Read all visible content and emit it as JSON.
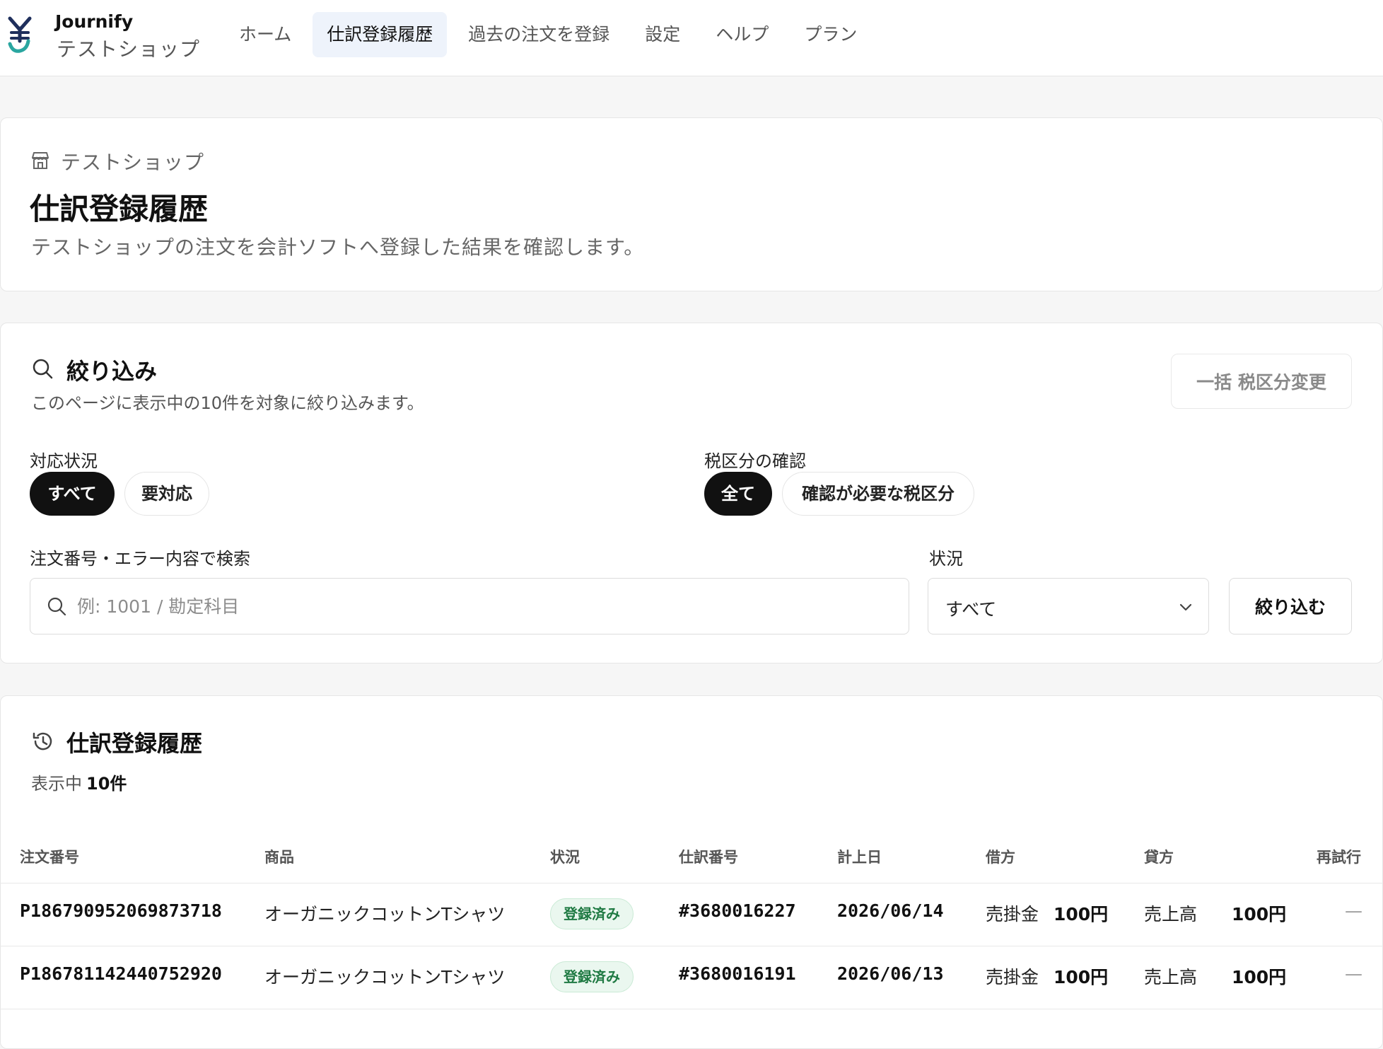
{
  "app": {
    "brand_name": "Journify",
    "shop_name": "テストショップ"
  },
  "nav": {
    "items": [
      {
        "label": "ホーム",
        "active": false
      },
      {
        "label": "仕訳登録履歴",
        "active": true
      },
      {
        "label": "過去の注文を登録",
        "active": false
      },
      {
        "label": "設定",
        "active": false
      },
      {
        "label": "ヘルプ",
        "active": false
      },
      {
        "label": "プラン",
        "active": false
      }
    ]
  },
  "header": {
    "store_label": "テストショップ",
    "title": "仕訳登録履歴",
    "description": "テストショップの注文を会計ソフトへ登録した結果を確認します。"
  },
  "filter": {
    "title": "絞り込み",
    "description": "このページに表示中の10件を対象に絞り込みます。",
    "bulk_button": "一括 税区分変更",
    "status_group": {
      "label": "対応状況",
      "options": [
        "すべて",
        "要対応"
      ],
      "selected": "すべて"
    },
    "tax_group": {
      "label": "税区分の確認",
      "options": [
        "全て",
        "確認が必要な税区分"
      ],
      "selected": "全て"
    },
    "search": {
      "label": "注文番号・エラー内容で検索",
      "placeholder": "例: 1001 / 勘定科目",
      "value": ""
    },
    "state_select": {
      "label": "状況",
      "value": "すべて"
    },
    "apply_button": "絞り込む"
  },
  "history": {
    "title": "仕訳登録履歴",
    "count_prefix": "表示中",
    "count_value": "10件",
    "columns": [
      "注文番号",
      "商品",
      "状況",
      "仕訳番号",
      "計上日",
      "借方",
      "貸方",
      "再試行"
    ],
    "rows": [
      {
        "order_no": "P186790952069873718",
        "product": "オーガニックコットンTシャツ",
        "status": "登録済み",
        "journal_no": "#3680016227",
        "date": "2026/06/14",
        "debit_account": "売掛金",
        "debit_amount": "100円",
        "credit_account": "売上高",
        "credit_amount": "100円",
        "retry": "—"
      },
      {
        "order_no": "P186781142440752920",
        "product": "オーガニックコットンTシャツ",
        "status": "登録済み",
        "journal_no": "#3680016191",
        "date": "2026/06/13",
        "debit_account": "売掛金",
        "debit_amount": "100円",
        "credit_account": "売上高",
        "credit_amount": "100円",
        "retry": "—"
      }
    ]
  },
  "colors": {
    "accent_nav_bg": "#eef3fb",
    "pill_selected": "#111111",
    "badge_green": "#1f7a43",
    "badge_green_bg": "#eaf7ef",
    "logo_navy": "#1f2f5c",
    "logo_teal": "#2aa6a0"
  },
  "icons": {
    "logo": "journify-yen-logo",
    "store": "store-icon",
    "filter": "search-icon",
    "history": "history-icon",
    "search": "search-icon",
    "select": "chevron-down-icon"
  }
}
